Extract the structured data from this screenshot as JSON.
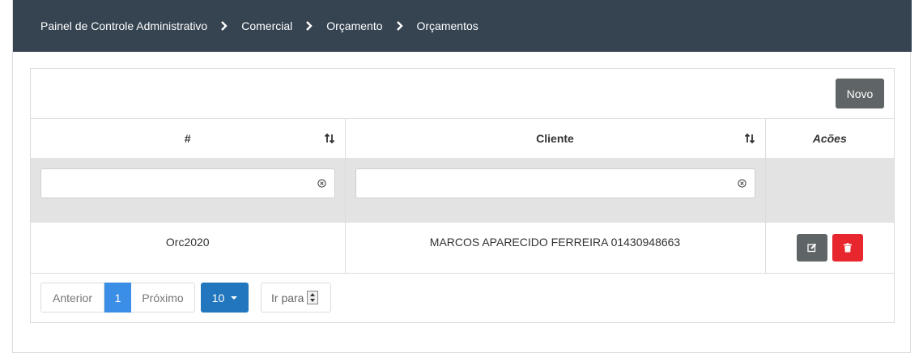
{
  "breadcrumb": [
    "Painel de Controle Administrativo",
    "Comercial",
    "Orçamento",
    "Orçamentos"
  ],
  "toolbar": {
    "new_label": "Novo"
  },
  "table": {
    "columns": [
      "#",
      "Cliente",
      "Acões"
    ],
    "filters": {
      "id_value": "",
      "cliente_value": ""
    },
    "rows": [
      {
        "id": "Orc2020",
        "cliente": "MARCOS APARECIDO FERREIRA 01430948663"
      }
    ]
  },
  "pagination": {
    "prev_label": "Anterior",
    "current_page": "1",
    "next_label": "Próximo",
    "page_size": "10",
    "goto_label": "Ir para"
  },
  "colors": {
    "header_bg": "#364452",
    "primary": "#2176bd",
    "active_page": "#3a8ee6",
    "danger": "#e8262d",
    "secondary": "#5f6466"
  },
  "icons": {
    "breadcrumb_separator": "chevron-right-icon",
    "sort": "sort-icon",
    "clear": "clear-circle-icon",
    "edit": "edit-icon",
    "delete": "trash-icon"
  }
}
